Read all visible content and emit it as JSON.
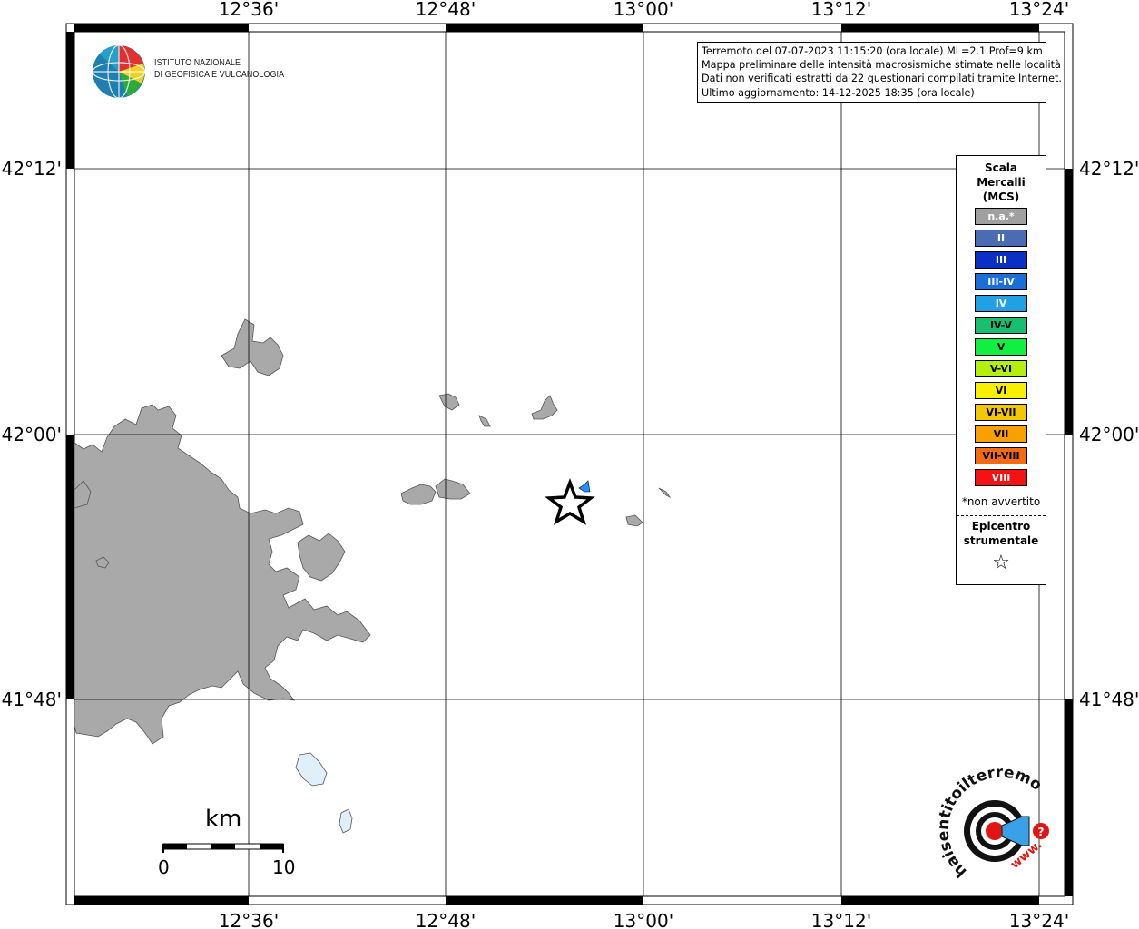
{
  "map": {
    "grid_labels": {
      "top_lon": [
        "12°36'",
        "12°48'",
        "13°00'",
        "13°12'",
        "13°24'"
      ],
      "bottom_lon": [
        "12°36'",
        "12°48'",
        "13°00'",
        "13°12'",
        "13°24'"
      ],
      "left_lat": [
        "42°12'",
        "42°00'",
        "41°48'"
      ],
      "right_lat": [
        "42°12'",
        "42°00'",
        "41°48'"
      ]
    },
    "info_lines": [
      "Terremoto del 07-07-2023 11:15:20 (ora locale) ML=2.1 Prof=9 km",
      "Mappa preliminare delle intensità macrosismiche stimate nelle località",
      "Dati non verificati estratti da 22 questionari compilati tramite Internet.",
      "Ultimo aggiornamento: 14-12-2025 18:35 (ora locale)"
    ],
    "logo_text": [
      "ISTITUTO NAZIONALE",
      "DI GEOFISICA E VULCANOLOGIA"
    ],
    "scale": {
      "unit": "km",
      "start": "0",
      "end": "10"
    },
    "epicenter_marker": "star-icon",
    "observation_marker": {
      "intensity": "IV",
      "color": "#1e90ff"
    },
    "colors": {
      "urban": "#a9a9a9",
      "water": "#dff0fa",
      "grid": "#000000"
    }
  },
  "legend": {
    "title": [
      "Scala",
      "Mercalli",
      "(MCS)"
    ],
    "items": [
      {
        "label": "n.a.*",
        "color": "#a0a0a0",
        "text_color": "#ffffff"
      },
      {
        "label": "II",
        "color": "#4a6cb4",
        "text_color": "#ffffff"
      },
      {
        "label": "III",
        "color": "#0a2fc4",
        "text_color": "#ffffff"
      },
      {
        "label": "III-IV",
        "color": "#1a6fd6",
        "text_color": "#ffffff"
      },
      {
        "label": "IV",
        "color": "#22a0e6",
        "text_color": "#ffffff"
      },
      {
        "label": "IV-V",
        "color": "#16c070",
        "text_color": "#000000"
      },
      {
        "label": "V",
        "color": "#10f040",
        "text_color": "#000000"
      },
      {
        "label": "V-VI",
        "color": "#b4f00a",
        "text_color": "#000000"
      },
      {
        "label": "VI",
        "color": "#f8f000",
        "text_color": "#000000"
      },
      {
        "label": "VI-VII",
        "color": "#f4c800",
        "text_color": "#000000"
      },
      {
        "label": "VII",
        "color": "#f8a000",
        "text_color": "#000000"
      },
      {
        "label": "VII-VIII",
        "color": "#f46a12",
        "text_color": "#000000"
      },
      {
        "label": "VIII",
        "color": "#f41212",
        "text_color": "#ffffff"
      }
    ],
    "note": "*non avvertito",
    "epicenter_title": [
      "Epicentro",
      "strumentale"
    ],
    "epicenter_icon": "star-outline-icon"
  },
  "haisentito_logo": {
    "text": "haisentitoilterremoto.it",
    "prefix": "www.",
    "icon": "speaker-target-icon"
  }
}
